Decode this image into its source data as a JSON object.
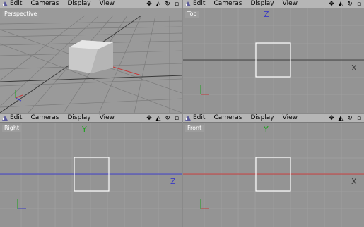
{
  "menu": {
    "items": [
      "Edit",
      "Cameras",
      "Display",
      "View"
    ],
    "controls": [
      "move-icon",
      "zoom-icon",
      "rotate-icon",
      "maximize-icon"
    ]
  },
  "viewports": {
    "perspective": {
      "label": "Perspective"
    },
    "top": {
      "label": "Top",
      "axis_h": "X",
      "axis_v": "Z"
    },
    "right": {
      "label": "Right",
      "axis_h": "Z",
      "axis_v": "Y"
    },
    "front": {
      "label": "Front",
      "axis_h": "X",
      "axis_v": "Y"
    }
  },
  "colors": {
    "grid_line": "#a5a5a5",
    "axis_dark": "#3a3a3a",
    "axis_red": "#c33a3a",
    "axis_blue": "#3a3ac3",
    "axis_green": "#1ca11c",
    "object_outline": "#ffffff"
  }
}
